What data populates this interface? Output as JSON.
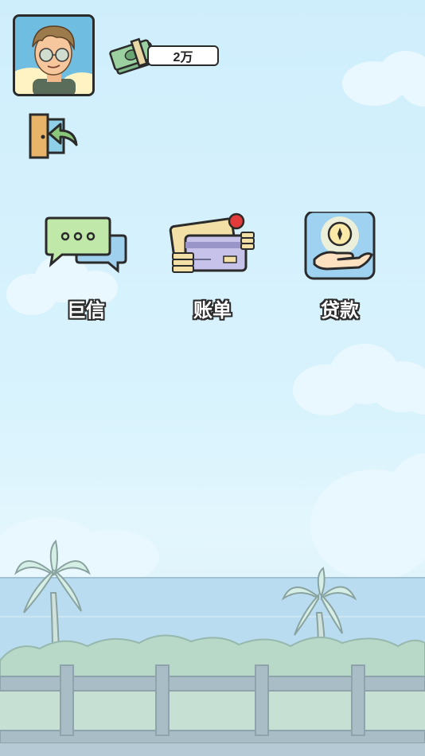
{
  "player": {
    "avatar_alt": "player-avatar"
  },
  "money": {
    "amount": "2万"
  },
  "apps": [
    {
      "label": "巨信"
    },
    {
      "label": "账单"
    },
    {
      "label": "贷款"
    }
  ],
  "colors": {
    "sky": "#cfeefc",
    "sea": "#b9dcf0",
    "hedge": "#b8d8c8",
    "fence": "#a9bdc7",
    "outline": "#2b2b2b"
  }
}
